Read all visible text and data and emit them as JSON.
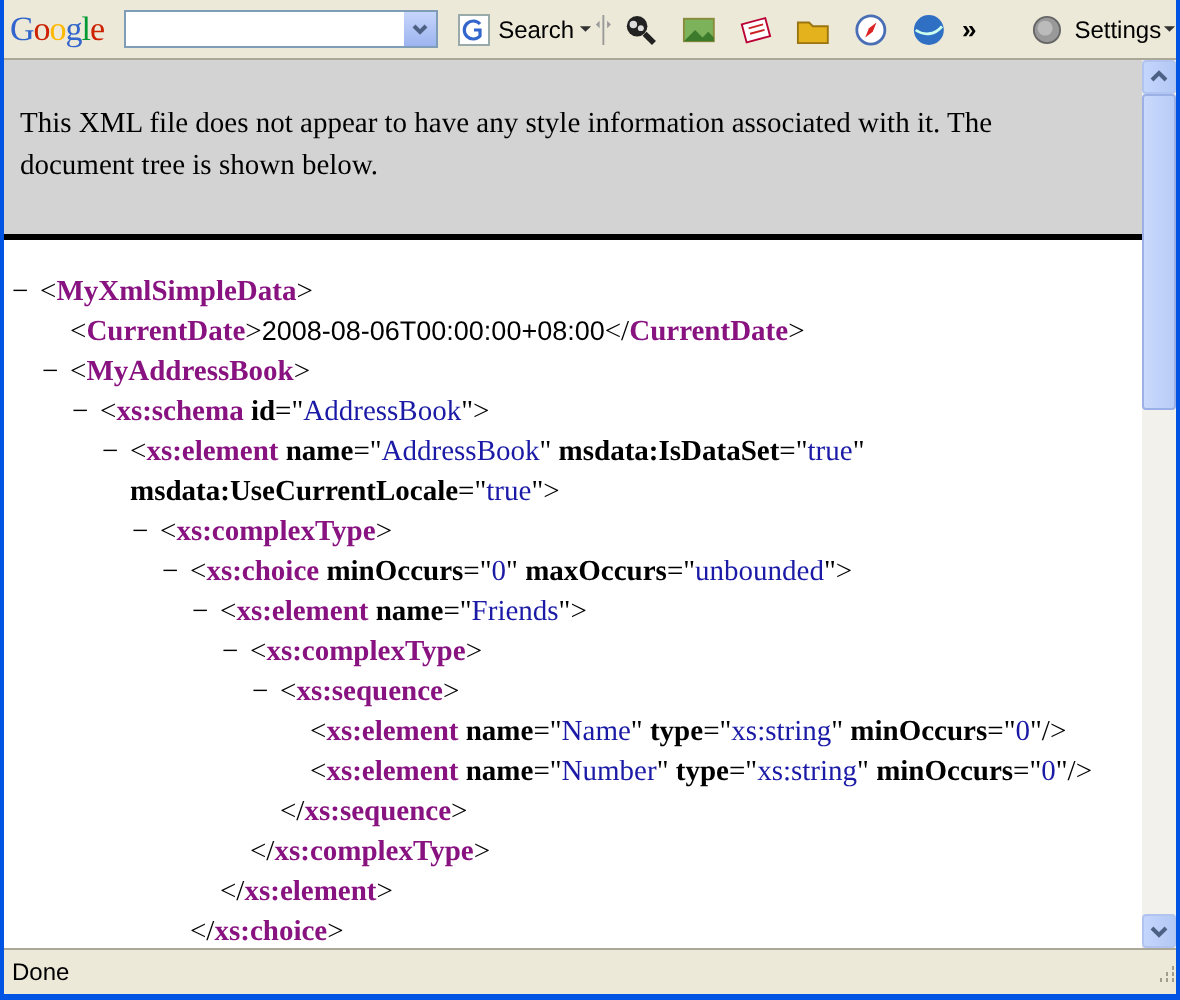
{
  "toolbar": {
    "logo": "Google",
    "search_button": "Search",
    "overflow": "»",
    "settings": "Settings"
  },
  "notice": "This XML file does not appear to have any style information associated with it. The document tree is shown below.",
  "tree": {
    "toggle": "−",
    "lines": [
      [
        {
          "kind": "punct",
          "text": "<"
        },
        {
          "kind": "tag",
          "text": "MyXmlSimpleData"
        },
        {
          "kind": "punct",
          "text": ">"
        }
      ]
    ],
    "children": [
      {
        "lines": [
          [
            {
              "kind": "punct",
              "text": "<"
            },
            {
              "kind": "tag",
              "text": "CurrentDate"
            },
            {
              "kind": "punct",
              "text": ">"
            },
            {
              "kind": "text",
              "text": "2008-08-06T00:00:00+08:00"
            },
            {
              "kind": "punct",
              "text": "</"
            },
            {
              "kind": "tag",
              "text": "CurrentDate"
            },
            {
              "kind": "punct",
              "text": ">"
            }
          ]
        ]
      },
      {
        "toggle": "−",
        "lines": [
          [
            {
              "kind": "punct",
              "text": "<"
            },
            {
              "kind": "tag",
              "text": "MyAddressBook"
            },
            {
              "kind": "punct",
              "text": ">"
            }
          ]
        ],
        "children": [
          {
            "toggle": "−",
            "lines": [
              [
                {
                  "kind": "punct",
                  "text": "<"
                },
                {
                  "kind": "tag",
                  "text": "xs:schema"
                },
                {
                  "kind": "attr",
                  "text": " id"
                },
                {
                  "kind": "punct",
                  "text": "=\""
                },
                {
                  "kind": "value",
                  "text": "AddressBook"
                },
                {
                  "kind": "punct",
                  "text": "\">"
                }
              ]
            ],
            "children": [
              {
                "toggle": "−",
                "lines": [
                  [
                    {
                      "kind": "punct",
                      "text": "<"
                    },
                    {
                      "kind": "tag",
                      "text": "xs:element"
                    },
                    {
                      "kind": "attr",
                      "text": " name"
                    },
                    {
                      "kind": "punct",
                      "text": "=\""
                    },
                    {
                      "kind": "value",
                      "text": "AddressBook"
                    },
                    {
                      "kind": "punct",
                      "text": "\""
                    },
                    {
                      "kind": "attr",
                      "text": " msdata:IsDataSet"
                    },
                    {
                      "kind": "punct",
                      "text": "=\""
                    },
                    {
                      "kind": "value",
                      "text": "true"
                    },
                    {
                      "kind": "punct",
                      "text": "\""
                    }
                  ],
                  [
                    {
                      "kind": "attr",
                      "text": "msdata:UseCurrentLocale"
                    },
                    {
                      "kind": "punct",
                      "text": "=\""
                    },
                    {
                      "kind": "value",
                      "text": "true"
                    },
                    {
                      "kind": "punct",
                      "text": "\">"
                    }
                  ]
                ],
                "children": [
                  {
                    "toggle": "−",
                    "lines": [
                      [
                        {
                          "kind": "punct",
                          "text": "<"
                        },
                        {
                          "kind": "tag",
                          "text": "xs:complexType"
                        },
                        {
                          "kind": "punct",
                          "text": ">"
                        }
                      ]
                    ],
                    "children": [
                      {
                        "toggle": "−",
                        "lines": [
                          [
                            {
                              "kind": "punct",
                              "text": "<"
                            },
                            {
                              "kind": "tag",
                              "text": "xs:choice"
                            },
                            {
                              "kind": "attr",
                              "text": " minOccurs"
                            },
                            {
                              "kind": "punct",
                              "text": "=\""
                            },
                            {
                              "kind": "value",
                              "text": "0"
                            },
                            {
                              "kind": "punct",
                              "text": "\""
                            },
                            {
                              "kind": "attr",
                              "text": " maxOccurs"
                            },
                            {
                              "kind": "punct",
                              "text": "=\""
                            },
                            {
                              "kind": "value",
                              "text": "unbounded"
                            },
                            {
                              "kind": "punct",
                              "text": "\">"
                            }
                          ]
                        ],
                        "children": [
                          {
                            "toggle": "−",
                            "lines": [
                              [
                                {
                                  "kind": "punct",
                                  "text": "<"
                                },
                                {
                                  "kind": "tag",
                                  "text": "xs:element"
                                },
                                {
                                  "kind": "attr",
                                  "text": " name"
                                },
                                {
                                  "kind": "punct",
                                  "text": "=\""
                                },
                                {
                                  "kind": "value",
                                  "text": "Friends"
                                },
                                {
                                  "kind": "punct",
                                  "text": "\">"
                                }
                              ]
                            ],
                            "children": [
                              {
                                "toggle": "−",
                                "lines": [
                                  [
                                    {
                                      "kind": "punct",
                                      "text": "<"
                                    },
                                    {
                                      "kind": "tag",
                                      "text": "xs:complexType"
                                    },
                                    {
                                      "kind": "punct",
                                      "text": ">"
                                    }
                                  ]
                                ],
                                "children": [
                                  {
                                    "toggle": "−",
                                    "lines": [
                                      [
                                        {
                                          "kind": "punct",
                                          "text": "<"
                                        },
                                        {
                                          "kind": "tag",
                                          "text": "xs:sequence"
                                        },
                                        {
                                          "kind": "punct",
                                          "text": ">"
                                        }
                                      ]
                                    ],
                                    "children": [
                                      {
                                        "lines": [
                                          [
                                            {
                                              "kind": "punct",
                                              "text": "<"
                                            },
                                            {
                                              "kind": "tag",
                                              "text": "xs:element"
                                            },
                                            {
                                              "kind": "attr",
                                              "text": " name"
                                            },
                                            {
                                              "kind": "punct",
                                              "text": "=\""
                                            },
                                            {
                                              "kind": "value",
                                              "text": "Name"
                                            },
                                            {
                                              "kind": "punct",
                                              "text": "\""
                                            },
                                            {
                                              "kind": "attr",
                                              "text": " type"
                                            },
                                            {
                                              "kind": "punct",
                                              "text": "=\""
                                            },
                                            {
                                              "kind": "value",
                                              "text": "xs:string"
                                            },
                                            {
                                              "kind": "punct",
                                              "text": "\""
                                            },
                                            {
                                              "kind": "attr",
                                              "text": " minOccurs"
                                            },
                                            {
                                              "kind": "punct",
                                              "text": "=\""
                                            },
                                            {
                                              "kind": "value",
                                              "text": "0"
                                            },
                                            {
                                              "kind": "punct",
                                              "text": "\"/>"
                                            }
                                          ]
                                        ]
                                      },
                                      {
                                        "lines": [
                                          [
                                            {
                                              "kind": "punct",
                                              "text": "<"
                                            },
                                            {
                                              "kind": "tag",
                                              "text": "xs:element"
                                            },
                                            {
                                              "kind": "attr",
                                              "text": " name"
                                            },
                                            {
                                              "kind": "punct",
                                              "text": "=\""
                                            },
                                            {
                                              "kind": "value",
                                              "text": "Number"
                                            },
                                            {
                                              "kind": "punct",
                                              "text": "\""
                                            },
                                            {
                                              "kind": "attr",
                                              "text": " type"
                                            },
                                            {
                                              "kind": "punct",
                                              "text": "=\""
                                            },
                                            {
                                              "kind": "value",
                                              "text": "xs:string"
                                            },
                                            {
                                              "kind": "punct",
                                              "text": "\""
                                            },
                                            {
                                              "kind": "attr",
                                              "text": " minOccurs"
                                            },
                                            {
                                              "kind": "punct",
                                              "text": "=\""
                                            },
                                            {
                                              "kind": "value",
                                              "text": "0"
                                            },
                                            {
                                              "kind": "punct",
                                              "text": "\"/>"
                                            }
                                          ]
                                        ]
                                      }
                                    ],
                                    "close": [
                                      {
                                        "kind": "punct",
                                        "text": "</"
                                      },
                                      {
                                        "kind": "tag",
                                        "text": "xs:sequence"
                                      },
                                      {
                                        "kind": "punct",
                                        "text": ">"
                                      }
                                    ]
                                  }
                                ],
                                "close": [
                                  {
                                    "kind": "punct",
                                    "text": "</"
                                  },
                                  {
                                    "kind": "tag",
                                    "text": "xs:complexType"
                                  },
                                  {
                                    "kind": "punct",
                                    "text": ">"
                                  }
                                ]
                              }
                            ],
                            "close": [
                              {
                                "kind": "punct",
                                "text": "</"
                              },
                              {
                                "kind": "tag",
                                "text": "xs:element"
                              },
                              {
                                "kind": "punct",
                                "text": ">"
                              }
                            ]
                          }
                        ],
                        "close": [
                          {
                            "kind": "punct",
                            "text": "</"
                          },
                          {
                            "kind": "tag",
                            "text": "xs:choice"
                          },
                          {
                            "kind": "punct",
                            "text": ">"
                          }
                        ]
                      }
                    ]
                  }
                ]
              }
            ]
          }
        ]
      }
    ]
  },
  "status_bar": "Done"
}
